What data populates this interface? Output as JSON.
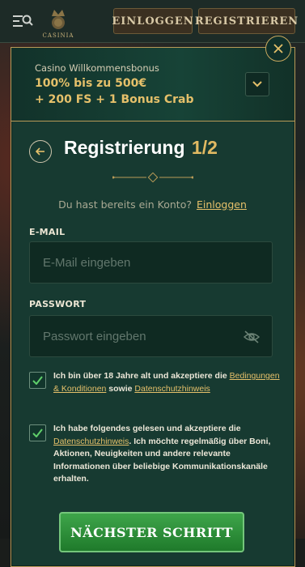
{
  "header": {
    "logo_text": "CASINIA",
    "login_label": "EINLOGGEN",
    "register_label": "REGISTRIEREN"
  },
  "bonus": {
    "title": "Casino Willkommensbonus",
    "line1": "100% bis zu 500€",
    "line2": "+ 200 FS + 1 Bonus Crab"
  },
  "form": {
    "title": "Registrierung",
    "step": "1/2",
    "have_account_text": "Du hast bereits ein Konto?",
    "login_link": "Einloggen",
    "email_label": "E-MAIL",
    "email_placeholder": "E-Mail eingeben",
    "email_value": "",
    "password_label": "PASSWORT",
    "password_placeholder": "Passwort eingeben",
    "password_value": "",
    "consent1": {
      "checked": true,
      "text_a": "Ich bin über 18 Jahre alt und akzeptiere die ",
      "link1": "Bedingungen & Konditionen",
      "text_b": " sowie ",
      "link2": "Datenschutzhinweis"
    },
    "consent2": {
      "checked": true,
      "text_a": "Ich habe folgendes gelesen und akzeptiere die ",
      "link1": "Datenschutzhinweis",
      "text_b": ". Ich möchte regelmäßig über Boni, Aktionen, Neuigkeiten und andere relevante Informationen über beliebige Kommunikationskanäle erhalten."
    },
    "next_label": "NÄCHSTER SCHRITT"
  },
  "colors": {
    "accent_gold": "#e5c06a",
    "modal_bg": "#173a31",
    "button_green": "#2f9a3c"
  },
  "icons": [
    "menu-search-icon",
    "casinia-logo",
    "close-icon",
    "chevron-down-icon",
    "arrow-left-icon",
    "eye-off-icon",
    "checkmark-icon"
  ]
}
